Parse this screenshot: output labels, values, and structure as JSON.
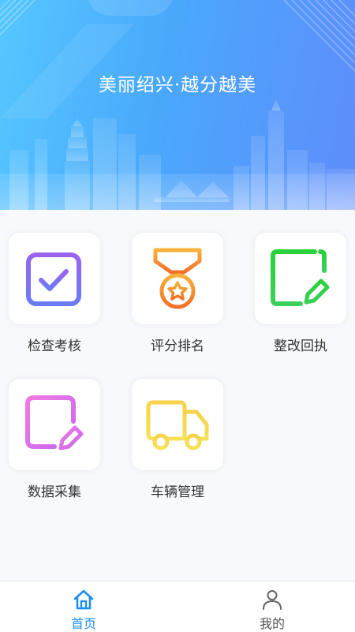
{
  "banner": {
    "slogan": "美丽绍兴·越分越美"
  },
  "menu": {
    "items": [
      {
        "label": "检查考核",
        "icon": "calendar-check-icon",
        "color": "#7b6cf6"
      },
      {
        "label": "评分排名",
        "icon": "medal-icon",
        "color": "#f7922d"
      },
      {
        "label": "整改回执",
        "icon": "text-edit-icon",
        "color": "#2fd13a"
      },
      {
        "label": "数据采集",
        "icon": "document-edit-icon",
        "color": "#e56ee6"
      },
      {
        "label": "车辆管理",
        "icon": "truck-icon",
        "color": "#f5d646"
      }
    ]
  },
  "tabbar": {
    "active_color": "#1f8ff0",
    "inactive_color": "#555555",
    "tabs": [
      {
        "label": "首页",
        "icon": "home-icon",
        "active": true
      },
      {
        "label": "我的",
        "icon": "user-icon",
        "active": false
      }
    ]
  }
}
